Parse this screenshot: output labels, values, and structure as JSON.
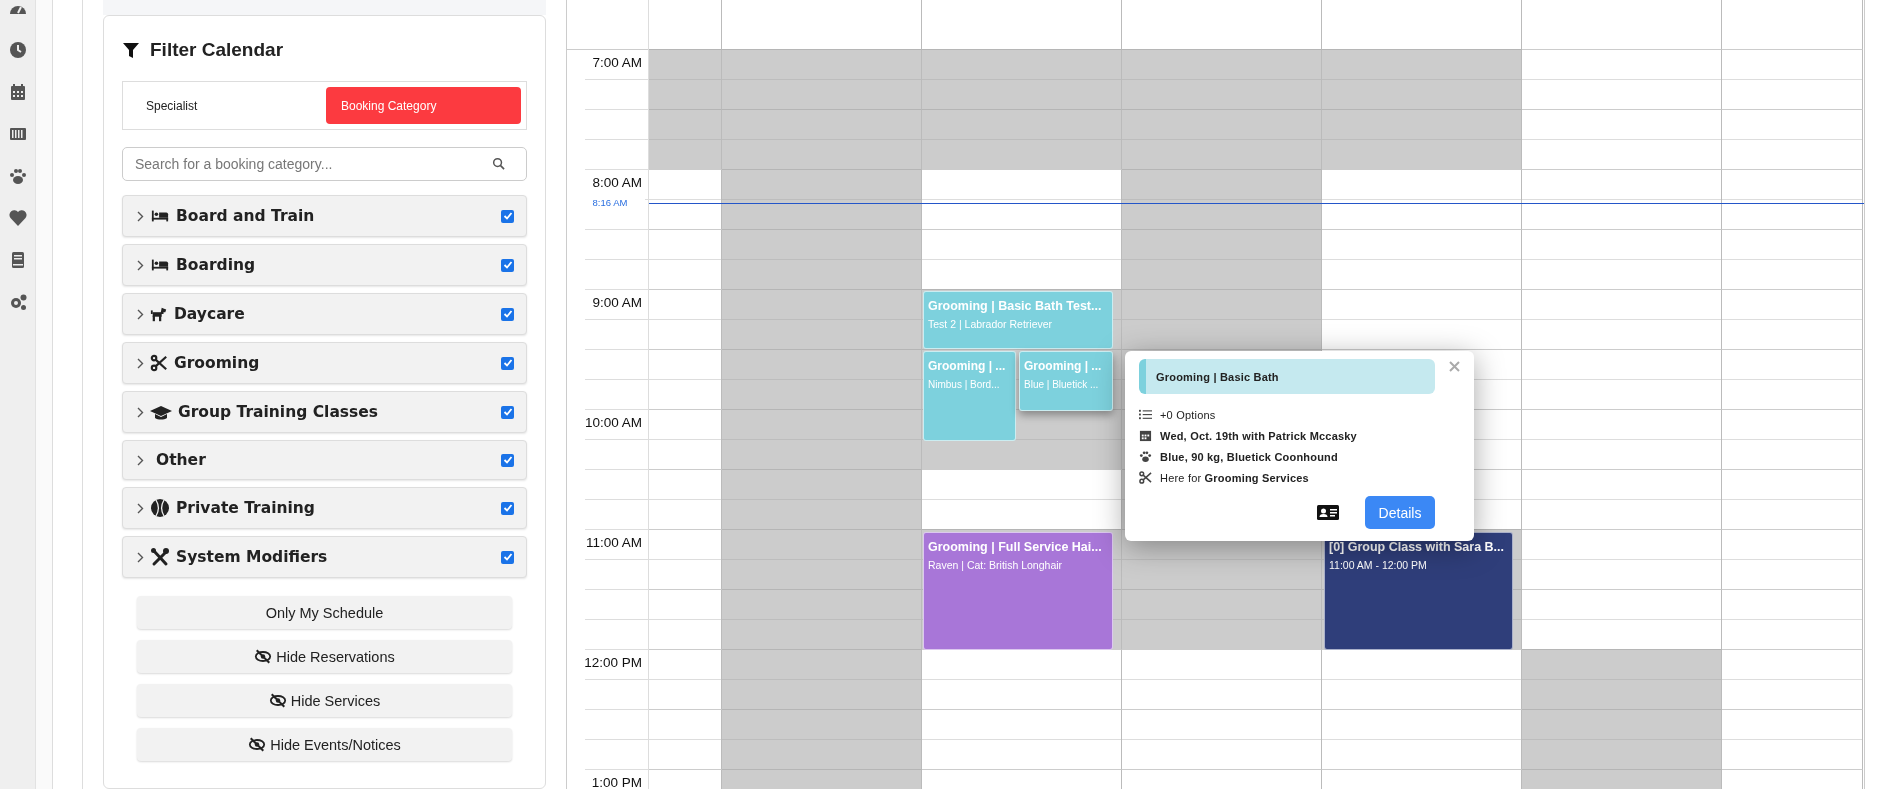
{
  "filter": {
    "title": "Filter Calendar",
    "modes": [
      {
        "label": "Specialist",
        "selected": false
      },
      {
        "label": "Booking Category",
        "selected": true
      }
    ],
    "search": {
      "placeholder": "Search for a booking category..."
    },
    "categories": [
      {
        "label": "Board and Train",
        "kind": "bed",
        "checked": true,
        "expanded": false
      },
      {
        "label": "Boarding",
        "kind": "bed",
        "checked": true,
        "expanded": false
      },
      {
        "label": "Daycare",
        "kind": "dog",
        "checked": true,
        "expanded": false
      },
      {
        "label": "Grooming",
        "kind": "scissors",
        "checked": true,
        "expanded": false
      },
      {
        "label": "Group Training Classes",
        "kind": "cap",
        "checked": true,
        "expanded": false
      },
      {
        "label": "Other",
        "kind": "none",
        "checked": true,
        "expanded": false
      },
      {
        "label": "Private Training",
        "kind": "ball",
        "checked": true,
        "expanded": false
      },
      {
        "label": "System Modifiers",
        "kind": "tools",
        "checked": true,
        "expanded": false
      }
    ],
    "buttons": [
      {
        "label": "Only My Schedule",
        "kind": "plain"
      },
      {
        "label": "Hide Reservations",
        "kind": "hide"
      },
      {
        "label": "Hide Services",
        "kind": "hide"
      },
      {
        "label": "Hide Events/Notices",
        "kind": "hide"
      }
    ]
  },
  "calendar": {
    "time_labels": [
      "7:00 AM",
      "8:00 AM",
      "9:00 AM",
      "10:00 AM",
      "11:00 AM",
      "12:00 PM",
      "1:00 PM"
    ],
    "now_label": "8:16 AM",
    "columns": [
      {
        "unavailable": [
          true,
          true,
          false,
          false,
          false,
          false,
          false,
          false,
          false,
          false,
          false,
          false,
          false
        ]
      },
      {
        "unavailable": [
          true,
          true,
          true,
          true,
          true,
          true,
          true,
          true,
          true,
          true,
          true,
          true,
          true
        ]
      },
      {
        "unavailable": [
          true,
          true,
          false,
          false,
          true,
          true,
          true,
          false,
          true,
          true,
          false,
          false,
          false
        ]
      },
      {
        "unavailable": [
          true,
          true,
          true,
          true,
          true,
          true,
          true,
          true,
          true,
          true,
          false,
          false,
          false
        ]
      },
      {
        "unavailable": [
          true,
          true,
          false,
          false,
          false,
          false,
          false,
          false,
          true,
          true,
          false,
          false,
          false
        ]
      },
      {
        "unavailable": [
          false,
          false,
          false,
          false,
          false,
          false,
          false,
          false,
          false,
          false,
          true,
          true,
          true
        ]
      },
      {
        "unavailable": [
          false,
          false,
          false,
          false,
          false,
          false,
          false,
          false,
          false,
          false,
          false,
          false,
          false
        ]
      }
    ],
    "events": [
      {
        "title": "Grooming | Basic Bath Test...",
        "subtitle": "Test 2 | Labrador Retriever",
        "color": "#7dd1dd"
      },
      {
        "title": "Grooming | ...",
        "subtitle": "Nimbus | Bord...",
        "color": "#7dd1dd"
      },
      {
        "title": "Grooming | ...",
        "subtitle": "Blue | Bluetick ...",
        "color": "#7dd1dd"
      },
      {
        "title": "Grooming | Full Service Hai...",
        "subtitle": "Raven | Cat: British Longhair",
        "color": "#a876d8"
      },
      {
        "title": "[0] Group Class with Sara B...",
        "subtitle": "11:00 AM - 12:00 PM",
        "color": "#2f3e7a"
      }
    ],
    "popup": {
      "title": "Grooming | Basic Bath",
      "lines": [
        {
          "kind": "options",
          "text": "+0 Options"
        },
        {
          "kind": "date",
          "text": "Wed, Oct. 19th with Patrick Mccasky"
        },
        {
          "kind": "pet",
          "text": "Blue, 90 kg, Bluetick Coonhound"
        },
        {
          "kind": "service",
          "text": "Here for **Grooming Services**"
        }
      ],
      "button": "Details"
    }
  }
}
